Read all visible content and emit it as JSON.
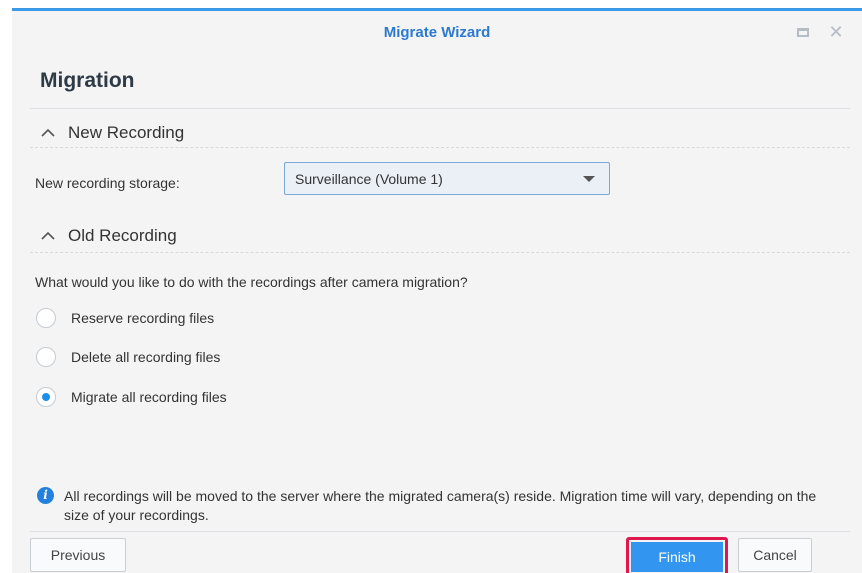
{
  "window": {
    "title": "Migrate Wizard",
    "accent_color": "#3a9ae8",
    "controls": {
      "minimize_icon": "window-restore-icon",
      "close_icon": "close-icon",
      "close_glyph": "✕"
    }
  },
  "page": {
    "heading": "Migration"
  },
  "new_recording": {
    "section_title": "New Recording",
    "storage_label": "New recording storage:",
    "storage_value": "Surveillance (Volume 1)"
  },
  "old_recording": {
    "section_title": "Old Recording",
    "question": "What would you like to do with the recordings after camera migration?",
    "options": [
      {
        "label": "Reserve recording files",
        "selected": false
      },
      {
        "label": "Delete all recording files",
        "selected": false
      },
      {
        "label": "Migrate all recording files",
        "selected": true
      }
    ]
  },
  "info": {
    "icon": "info-icon",
    "glyph": "i",
    "text": "All recordings will be moved to the server where the migrated camera(s) reside. Migration time will vary, depending on the size of your recordings."
  },
  "footer": {
    "previous_label": "Previous",
    "finish_label": "Finish",
    "cancel_label": "Cancel",
    "finish_color": "#3296f0",
    "highlight_color": "#e0174e"
  }
}
